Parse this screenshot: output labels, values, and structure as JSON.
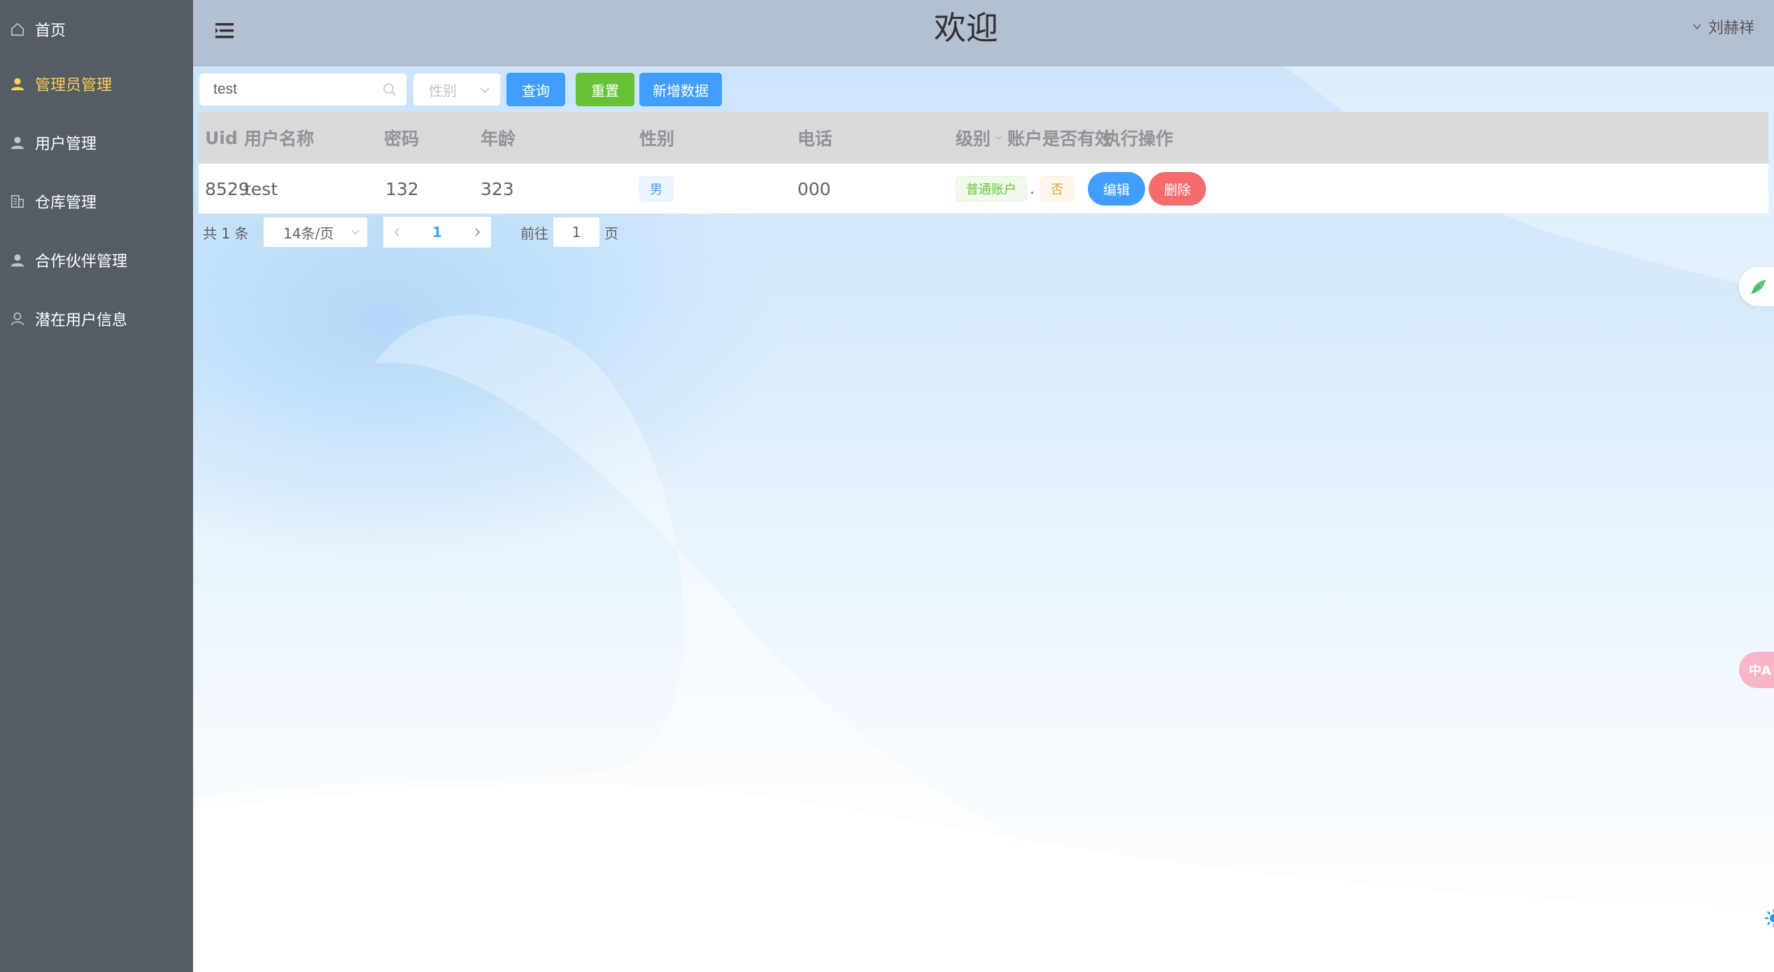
{
  "sidebar": {
    "items": [
      {
        "label": "首页",
        "icon": "home-icon",
        "active": false
      },
      {
        "label": "管理员管理",
        "icon": "user-icon",
        "active": true
      },
      {
        "label": "用户管理",
        "icon": "user-icon",
        "active": false
      },
      {
        "label": "仓库管理",
        "icon": "building-icon",
        "active": false
      },
      {
        "label": "合作伙伴管理",
        "icon": "user-icon",
        "active": false
      },
      {
        "label": "潜在用户信息",
        "icon": "user-outline-icon",
        "active": false
      }
    ],
    "colors": {
      "background": "#545c64",
      "text": "#ffffff",
      "active_text": "#ffd04b"
    }
  },
  "header": {
    "title": "欢迎",
    "user_name": "刘赫祥"
  },
  "toolbar": {
    "search_value": "test",
    "gender_placeholder": "性别",
    "query_label": "查询",
    "reset_label": "重置",
    "add_label": "新增数据"
  },
  "table": {
    "columns": [
      "Uid",
      "用户名称",
      "密码",
      "年龄",
      "性别",
      "电话",
      "级别",
      "账户是否有效",
      "执行操作"
    ],
    "rows": [
      {
        "uid": "8529",
        "username": "test",
        "password": "132",
        "age": "323",
        "gender": "男",
        "phone": "000",
        "level": "普通账户",
        "level_suffix": ".",
        "valid": "否",
        "edit_label": "编辑",
        "delete_label": "删除"
      }
    ]
  },
  "pagination": {
    "total_text": "共 1 条",
    "page_size": "14条/页",
    "current_page": "1",
    "goto_label": "前往",
    "goto_value": "1",
    "goto_suffix": "页"
  },
  "widgets": {
    "translate_text": "中A"
  },
  "colors": {
    "primary": "#409eff",
    "success": "#67c23a",
    "danger": "#f56c6c",
    "header_bg": "#b3c0d1",
    "table_header_bg": "#d9d9d9"
  }
}
